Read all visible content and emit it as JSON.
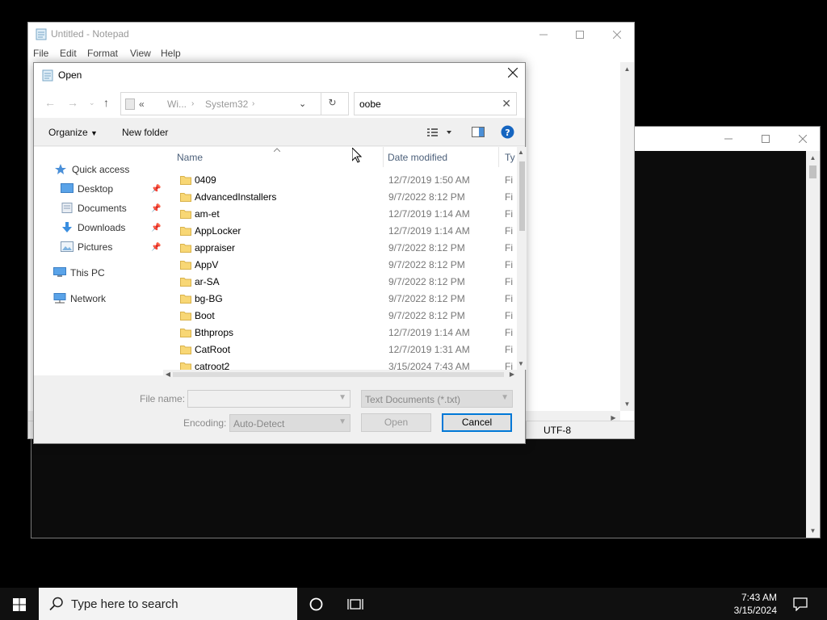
{
  "notepad": {
    "title": "Untitled - Notepad",
    "menu": [
      "File",
      "Edit",
      "Format",
      "View",
      "Help"
    ],
    "status_encoding": "UTF-8"
  },
  "dialog": {
    "title": "Open",
    "breadcrumb": {
      "overflow": "«",
      "parent": "Wi...",
      "current": "System32"
    },
    "search_value": "oobe",
    "toolbar": {
      "organize": "Organize",
      "new_folder": "New folder"
    },
    "nav": {
      "quick_access": "Quick access",
      "desktop": "Desktop",
      "documents": "Documents",
      "downloads": "Downloads",
      "pictures": "Pictures",
      "this_pc": "This PC",
      "network": "Network"
    },
    "columns": {
      "name": "Name",
      "date": "Date modified",
      "type": "Ty"
    },
    "files": [
      {
        "name": "0409",
        "date": "12/7/2019 1:50 AM",
        "type": "Fi"
      },
      {
        "name": "AdvancedInstallers",
        "date": "9/7/2022 8:12 PM",
        "type": "Fi"
      },
      {
        "name": "am-et",
        "date": "12/7/2019 1:14 AM",
        "type": "Fi"
      },
      {
        "name": "AppLocker",
        "date": "12/7/2019 1:14 AM",
        "type": "Fi"
      },
      {
        "name": "appraiser",
        "date": "9/7/2022 8:12 PM",
        "type": "Fi"
      },
      {
        "name": "AppV",
        "date": "9/7/2022 8:12 PM",
        "type": "Fi"
      },
      {
        "name": "ar-SA",
        "date": "9/7/2022 8:12 PM",
        "type": "Fi"
      },
      {
        "name": "bg-BG",
        "date": "9/7/2022 8:12 PM",
        "type": "Fi"
      },
      {
        "name": "Boot",
        "date": "9/7/2022 8:12 PM",
        "type": "Fi"
      },
      {
        "name": "Bthprops",
        "date": "12/7/2019 1:14 AM",
        "type": "Fi"
      },
      {
        "name": "CatRoot",
        "date": "12/7/2019 1:31 AM",
        "type": "Fi"
      },
      {
        "name": "catroot2",
        "date": "3/15/2024 7:43 AM",
        "type": "Fi"
      }
    ],
    "filename_label": "File name:",
    "filename_value": "",
    "filetype_value": "Text Documents (*.txt)",
    "encoding_label": "Encoding:",
    "encoding_value": "Auto-Detect",
    "open_label": "Open",
    "cancel_label": "Cancel"
  },
  "taskbar": {
    "search_placeholder": "Type here to search",
    "time": "7:43 AM",
    "date": "3/15/2024"
  },
  "colors": {
    "accent": "#0078d7",
    "help_blue": "#1565c0",
    "folder": "#f8d775"
  }
}
